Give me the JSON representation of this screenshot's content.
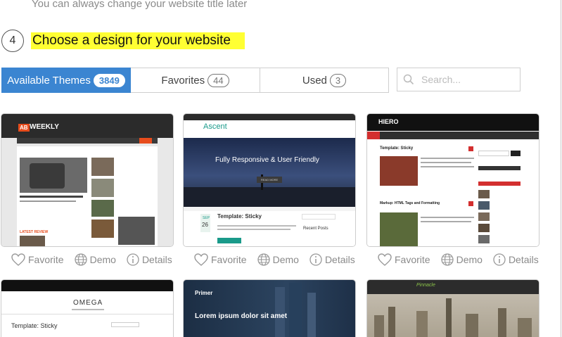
{
  "hint": "You can always change your website title later",
  "step": {
    "number": "4",
    "title": "Choose a design for your website"
  },
  "tabs": [
    {
      "label": "Available Themes",
      "count": "3849"
    },
    {
      "label": "Favorites",
      "count": "44"
    },
    {
      "label": "Used",
      "count": "3"
    }
  ],
  "search": {
    "placeholder": "Search..."
  },
  "actions": {
    "favorite": "Favorite",
    "demo": "Demo",
    "details": "Details"
  },
  "themes": {
    "t1": {
      "logo_a": "AB",
      "logo_b": "WEEKLY",
      "latest": "LATEST REVIEW"
    },
    "t2": {
      "logo": "Ascent",
      "hero": "Fully Responsive & User Friendly",
      "cta": "READ MORE",
      "month": "SEP",
      "day": "26",
      "post": "Template: Sticky",
      "sidebar": "Recent Posts"
    },
    "t3": {
      "logo": "HIERO",
      "post1": "Template: Sticky",
      "post2": "Markup: HTML Tags and Formatting"
    },
    "t4": {
      "logo": "OMEGA",
      "post": "Template: Sticky"
    },
    "t5": {
      "logo": "Primer",
      "post": "Lorem ipsum dolor sit amet"
    },
    "t6": {
      "logo": "Pinnacle"
    }
  },
  "colors": {
    "accent": "#3b85d1",
    "highlight": "#ffff33"
  }
}
